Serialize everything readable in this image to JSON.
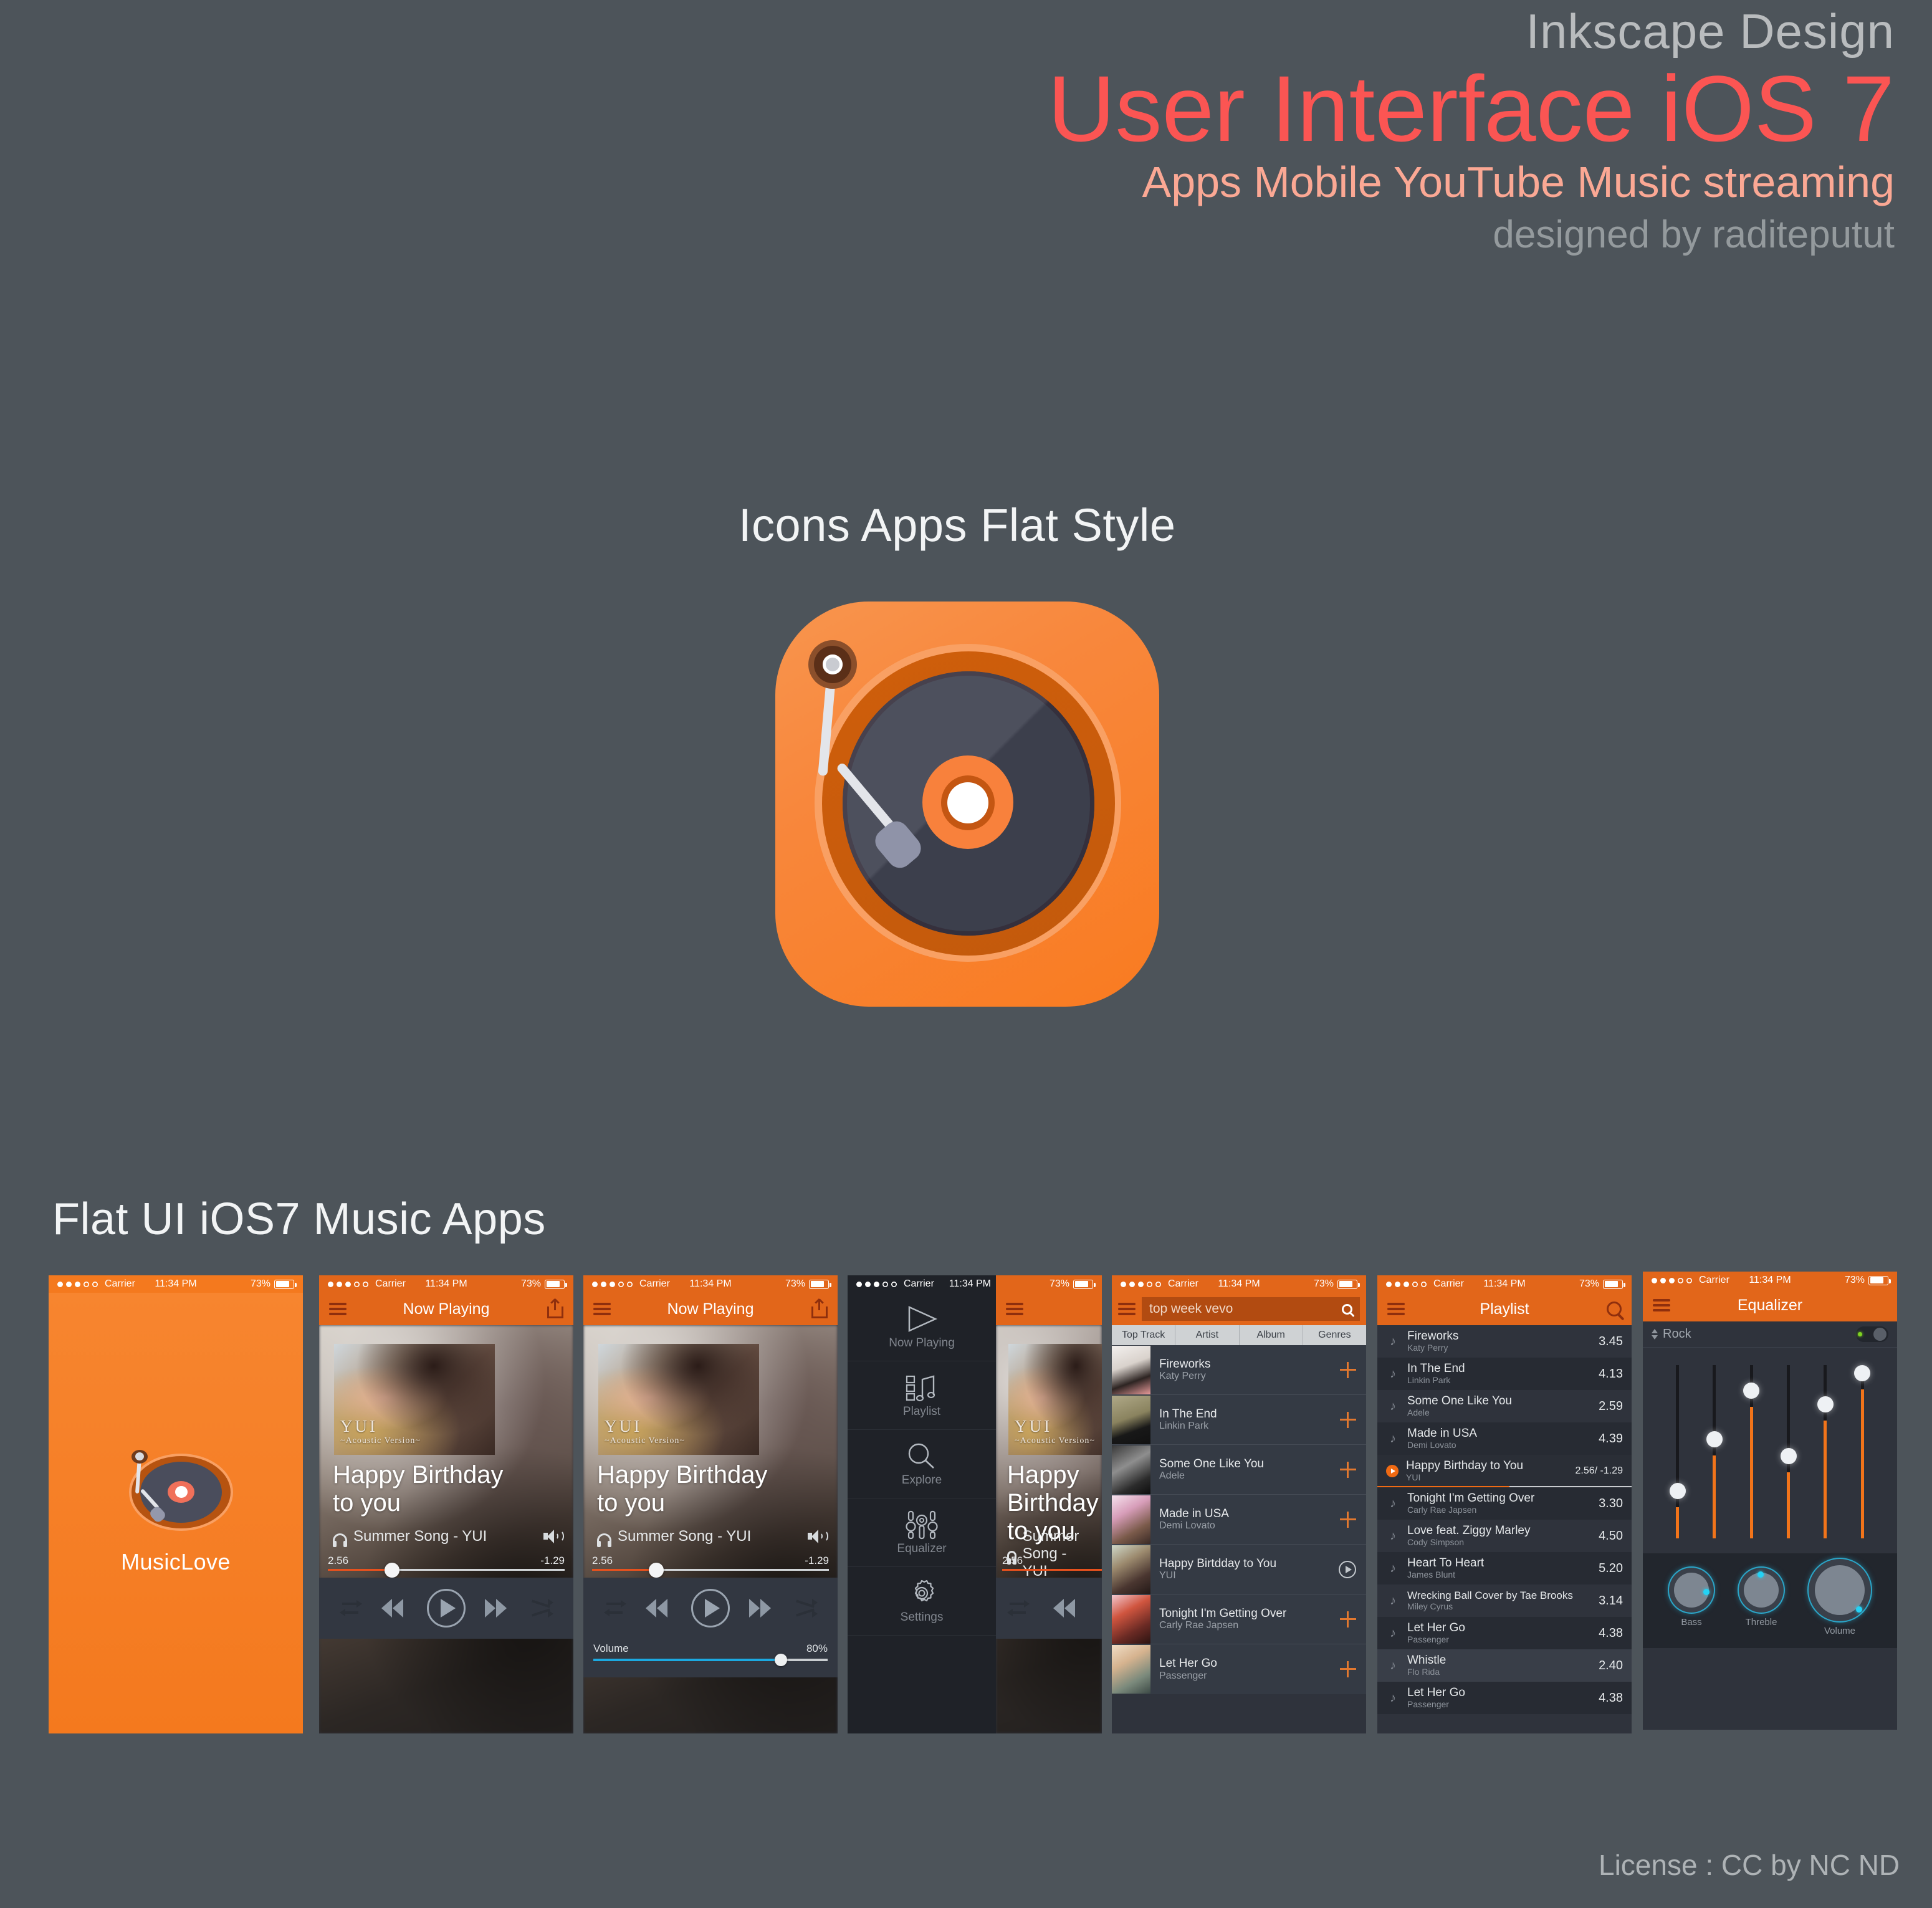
{
  "hero": {
    "line1": "Inkscape Design",
    "line2": "User Interface iOS 7",
    "line3": "Apps Mobile YouTube Music streaming",
    "line4": "designed by raditeputut"
  },
  "sections": {
    "icons_title": "Icons Apps Flat Style",
    "apps_title": "Flat UI iOS7 Music Apps",
    "license": "License : CC by NC ND"
  },
  "colors": {
    "background": "#4d545a",
    "accent_orange": "#e2661a",
    "accent_red": "#fb5553",
    "progress_orange": "#e8511d",
    "volume_blue": "#1ba9e1",
    "eq_orange": "#f2741a",
    "knob_cyan": "#24d2f5",
    "led_green": "#7ed321"
  },
  "status_bar": {
    "carrier": "Carrier",
    "time": "11:34 PM",
    "battery_percent": "73%",
    "signal_dots_filled": 3,
    "signal_dots_total": 5
  },
  "app_icon": {
    "name": "turntable-app-icon"
  },
  "screens": {
    "splash": {
      "app_name": "MusicLove"
    },
    "now_playing": {
      "nav_title": "Now Playing",
      "menu_icon": "hamburger-icon",
      "share_icon": "share-icon",
      "album_art_line1": "YUI",
      "album_art_line2": "~Acoustic Version~",
      "song_title": "Happy Birthday\nto you",
      "song_title_l1": "Happy Birthday",
      "song_title_l2": "to you",
      "subtitle": "Summer Song - YUI",
      "elapsed": "2.56",
      "remaining": "-1.29",
      "progress_percent": 27,
      "controls": [
        "repeat-icon",
        "previous-icon",
        "play-icon",
        "next-icon",
        "shuffle-icon"
      ],
      "volume_label": "Volume",
      "volume_value": "80%",
      "volume_percent": 80
    },
    "drawer": {
      "items": [
        {
          "label": "Now Playing",
          "icon": "play-outline-icon"
        },
        {
          "label": "Playlist",
          "icon": "playlist-music-icon"
        },
        {
          "label": "Explore",
          "icon": "magnifier-icon"
        },
        {
          "label": "Equalizer",
          "icon": "equalizer-sliders-icon"
        },
        {
          "label": "Settings",
          "icon": "gear-icon"
        }
      ]
    },
    "explore": {
      "search_value": "top week vevo",
      "search_icon": "search-icon",
      "tabs": [
        "Top Track",
        "Artist",
        "Album",
        "Genres"
      ],
      "active_tab": "Top Track",
      "results": [
        {
          "title": "Fireworks",
          "artist": "Katy Perry",
          "action": "add"
        },
        {
          "title": "In The End",
          "artist": "Linkin Park",
          "action": "add"
        },
        {
          "title": "Some One Like You",
          "artist": "Adele",
          "action": "add"
        },
        {
          "title": "Made in USA",
          "artist": "Demi Lovato",
          "action": "add"
        },
        {
          "title": "Happy Birtdday to You",
          "artist": "YUI",
          "action": "play"
        },
        {
          "title": "Tonight I'm Getting Over",
          "artist": "Carly Rae Japsen",
          "action": "add"
        },
        {
          "title": "Let Her Go",
          "artist": "Passenger",
          "action": "add"
        }
      ]
    },
    "playlist": {
      "nav_title": "Playlist",
      "search_icon": "search-icon",
      "tracks": [
        {
          "title": "Fireworks",
          "artist": "Katy Perry",
          "duration": "3.45",
          "playing": false
        },
        {
          "title": "In The End",
          "artist": "Linkin Park",
          "duration": "4.13",
          "playing": false
        },
        {
          "title": "Some One Like You",
          "artist": "Adele",
          "duration": "2.59",
          "playing": false
        },
        {
          "title": "Made in USA",
          "artist": "Demi Lovato",
          "duration": "4.39",
          "playing": false
        },
        {
          "title": "Happy Birthday to You",
          "artist": "YUI",
          "duration": "2.56/ -1.29",
          "playing": true
        },
        {
          "title": "Tonight I'm Getting Over",
          "artist": "Carly Rae Japsen",
          "duration": "3.30",
          "playing": false
        },
        {
          "title": "Love feat. Ziggy Marley",
          "artist": "Cody Simpson",
          "duration": "4.50",
          "playing": false
        },
        {
          "title": "Heart To Heart",
          "artist": "James Blunt",
          "duration": "5.20",
          "playing": false
        },
        {
          "title": "Wrecking Ball Cover by Tae Brooks",
          "artist": "Miley Cyrus",
          "duration": "3.14",
          "playing": false
        },
        {
          "title": "Let Her Go",
          "artist": "Passenger",
          "duration": "4.38",
          "playing": false
        },
        {
          "title": "Whistle",
          "artist": "Flo Rida",
          "duration": "2.40",
          "playing": false
        },
        {
          "title": "Let Her Go",
          "artist": "Passenger",
          "duration": "4.38",
          "playing": false
        }
      ]
    },
    "equalizer": {
      "nav_title": "Equalizer",
      "preset": "Rock",
      "enabled": true,
      "band_values": [
        18,
        48,
        76,
        38,
        68,
        86
      ],
      "knobs": [
        {
          "label": "Bass",
          "size": "small"
        },
        {
          "label": "Threble",
          "size": "small"
        },
        {
          "label": "Volume",
          "size": "large"
        }
      ]
    }
  }
}
